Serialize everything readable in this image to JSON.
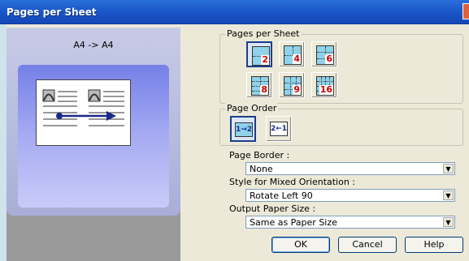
{
  "window": {
    "title": "Pages per Sheet"
  },
  "preview": {
    "label": "A4 -> A4"
  },
  "pages_per_sheet": {
    "legend": "Pages per Sheet",
    "legend_mnemonic": "S",
    "options": [
      "2",
      "4",
      "6",
      "8",
      "9",
      "16"
    ],
    "selected": "2"
  },
  "page_order": {
    "legend": "Page Order",
    "options": [
      {
        "label": "1→2",
        "selected": true
      },
      {
        "label": "2←1",
        "selected": false
      }
    ]
  },
  "page_border": {
    "label": "Page Border :",
    "value": "None"
  },
  "mixed_orientation": {
    "label": "Style for Mixed Orientation :",
    "value": "Rotate Left 90"
  },
  "output_paper_size": {
    "label": "Output Paper Size :",
    "value": "Same as Paper Size"
  },
  "buttons": {
    "ok": "OK",
    "cancel": "Cancel",
    "help": "Help"
  },
  "icons": {
    "dropdown": "chevron-down-icon",
    "preview_arrow": "arrow-right-icon"
  },
  "colors": {
    "title_bar": "#1a56c8",
    "dialog_bg": "#ece9d8",
    "preview_stage": "#8e95ee",
    "page_badge": "#d00000",
    "icon_fill": "#8fd3ea"
  }
}
